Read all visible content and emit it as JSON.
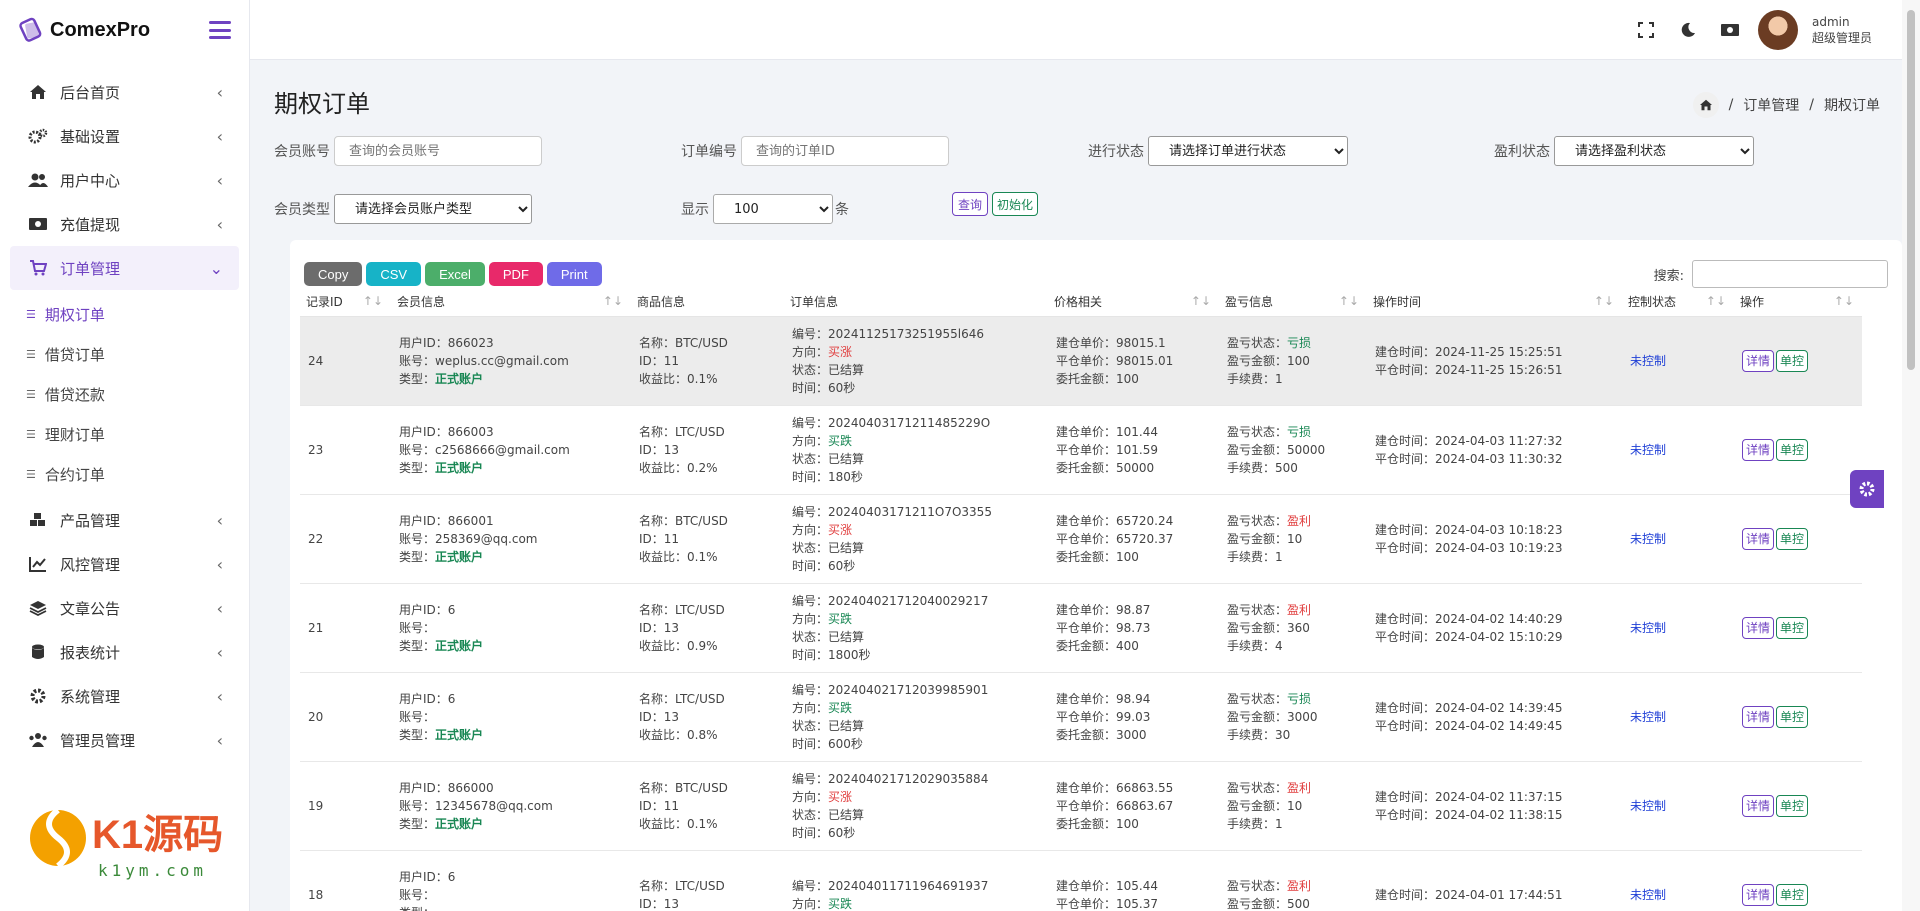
{
  "brand": {
    "name": "ComexPro"
  },
  "colors": {
    "accent": "#6f42c1",
    "green": "#198754",
    "red": "#e03e3e",
    "control": "#1f3fd6"
  },
  "sidebar": {
    "items": [
      {
        "label": "后台首页",
        "icon": "home-icon"
      },
      {
        "label": "基础设置",
        "icon": "gears-icon"
      },
      {
        "label": "用户中心",
        "icon": "users-icon"
      },
      {
        "label": "充值提现",
        "icon": "money-icon"
      },
      {
        "label": "订单管理",
        "icon": "cart-icon",
        "active": true
      },
      {
        "label": "产品管理",
        "icon": "cubes-icon"
      },
      {
        "label": "风控管理",
        "icon": "chart-line-icon"
      },
      {
        "label": "文章公告",
        "icon": "layers-icon"
      },
      {
        "label": "报表统计",
        "icon": "database-icon"
      },
      {
        "label": "系统管理",
        "icon": "gear-icon"
      },
      {
        "label": "管理员管理",
        "icon": "user-group-icon"
      }
    ],
    "submenu": [
      "期权订单",
      "借贷订单",
      "借贷还款",
      "理财订单",
      "合约订单"
    ]
  },
  "watermark": {
    "text": "K1源码",
    "url": "k1ym.com"
  },
  "user": {
    "name": "admin",
    "role": "超级管理员"
  },
  "page": {
    "title": "期权订单"
  },
  "breadcrumb": {
    "parent": "订单管理",
    "current": "期权订单",
    "sep": "/"
  },
  "filters": {
    "member_account_label": "会员账号",
    "member_account_placeholder": "查询的会员账号",
    "order_no_label": "订单编号",
    "order_no_placeholder": "查询的订单ID",
    "progress_label": "进行状态",
    "progress_value": "请选择订单进行状态",
    "profit_label": "盈利状态",
    "profit_value": "请选择盈利状态",
    "member_type_label": "会员类型",
    "member_type_value": "请选择会员账户类型",
    "show_label": "显示",
    "show_value": "100",
    "show_unit": "条",
    "query": "查询",
    "reset": "初始化"
  },
  "export": {
    "copy": "Copy",
    "csv": "CSV",
    "excel": "Excel",
    "pdf": "PDF",
    "print": "Print"
  },
  "search_label": "搜索:",
  "table": {
    "headers": [
      "记录ID",
      "会员信息",
      "商品信息",
      "订单信息",
      "价格相关",
      "盈亏信息",
      "操作时间",
      "控制状态",
      "操作"
    ],
    "rows": [
      {
        "id": "24",
        "uid": "用户ID：866023",
        "account": "账号：weplus.cc@gmail.com",
        "type_label": "类型：",
        "type": "正式账户",
        "product": "名称：BTC/USD",
        "pid": "ID：11",
        "ratio": "收益比：0.1%",
        "order_no": "编号：20241125173251955l646",
        "dir_label": "方向：",
        "dir": "买涨",
        "dir_color": "red",
        "state": "状态：已结算",
        "duration": "时间：60秒",
        "open_price": "建仓单价：98015.1",
        "close_price": "平仓单价：98015.01",
        "amount": "委托金额：100",
        "pl_label": "盈亏状态：",
        "pl": "亏损",
        "pl_color": "green",
        "pl_amount": "盈亏金额：100",
        "fee": "手续费：1",
        "open_time": "建仓时间：2024-11-25 15:25:51",
        "close_time": "平仓时间：2024-11-25 15:26:51",
        "control": "未控制",
        "detail": "详情",
        "single": "单控"
      },
      {
        "id": "23",
        "uid": "用户ID：866003",
        "account": "账号：c2568666@gmail.com",
        "type_label": "类型：",
        "type": "正式账户",
        "product": "名称：LTC/USD",
        "pid": "ID：13",
        "ratio": "收益比：0.2%",
        "order_no": "编号：20240403171211485229O",
        "dir_label": "方向：",
        "dir": "买跌",
        "dir_color": "green",
        "state": "状态：已结算",
        "duration": "时间：180秒",
        "open_price": "建仓单价：101.44",
        "close_price": "平仓单价：101.59",
        "amount": "委托金额：50000",
        "pl_label": "盈亏状态：",
        "pl": "亏损",
        "pl_color": "green",
        "pl_amount": "盈亏金额：50000",
        "fee": "手续费：500",
        "open_time": "建仓时间：2024-04-03 11:27:32",
        "close_time": "平仓时间：2024-04-03 11:30:32",
        "control": "未控制",
        "detail": "详情",
        "single": "单控"
      },
      {
        "id": "22",
        "uid": "用户ID：866001",
        "account": "账号：258369@qq.com",
        "type_label": "类型：",
        "type": "正式账户",
        "product": "名称：BTC/USD",
        "pid": "ID：11",
        "ratio": "收益比：0.1%",
        "order_no": "编号：20240403171211O7O3355",
        "dir_label": "方向：",
        "dir": "买涨",
        "dir_color": "red",
        "state": "状态：已结算",
        "duration": "时间：60秒",
        "open_price": "建仓单价：65720.24",
        "close_price": "平仓单价：65720.37",
        "amount": "委托金额：100",
        "pl_label": "盈亏状态：",
        "pl": "盈利",
        "pl_color": "red",
        "pl_amount": "盈亏金额：10",
        "fee": "手续费：1",
        "open_time": "建仓时间：2024-04-03 10:18:23",
        "close_time": "平仓时间：2024-04-03 10:19:23",
        "control": "未控制",
        "detail": "详情",
        "single": "单控"
      },
      {
        "id": "21",
        "uid": "用户ID：6",
        "account": "账号：",
        "type_label": "类型：",
        "type": "正式账户",
        "product": "名称：LTC/USD",
        "pid": "ID：13",
        "ratio": "收益比：0.9%",
        "order_no": "编号：202404021712040029217",
        "dir_label": "方向：",
        "dir": "买跌",
        "dir_color": "green",
        "state": "状态：已结算",
        "duration": "时间：1800秒",
        "open_price": "建仓单价：98.87",
        "close_price": "平仓单价：98.73",
        "amount": "委托金额：400",
        "pl_label": "盈亏状态：",
        "pl": "盈利",
        "pl_color": "red",
        "pl_amount": "盈亏金额：360",
        "fee": "手续费：4",
        "open_time": "建仓时间：2024-04-02 14:40:29",
        "close_time": "平仓时间：2024-04-02 15:10:29",
        "control": "未控制",
        "detail": "详情",
        "single": "单控"
      },
      {
        "id": "20",
        "uid": "用户ID：6",
        "account": "账号：",
        "type_label": "类型：",
        "type": "正式账户",
        "product": "名称：LTC/USD",
        "pid": "ID：13",
        "ratio": "收益比：0.8%",
        "order_no": "编号：202404021712039985901",
        "dir_label": "方向：",
        "dir": "买跌",
        "dir_color": "green",
        "state": "状态：已结算",
        "duration": "时间：600秒",
        "open_price": "建仓单价：98.94",
        "close_price": "平仓单价：99.03",
        "amount": "委托金额：3000",
        "pl_label": "盈亏状态：",
        "pl": "亏损",
        "pl_color": "green",
        "pl_amount": "盈亏金额：3000",
        "fee": "手续费：30",
        "open_time": "建仓时间：2024-04-02 14:39:45",
        "close_time": "平仓时间：2024-04-02 14:49:45",
        "control": "未控制",
        "detail": "详情",
        "single": "单控"
      },
      {
        "id": "19",
        "uid": "用户ID：866000",
        "account": "账号：12345678@qq.com",
        "type_label": "类型：",
        "type": "正式账户",
        "product": "名称：BTC/USD",
        "pid": "ID：11",
        "ratio": "收益比：0.1%",
        "order_no": "编号：202404021712029035884",
        "dir_label": "方向：",
        "dir": "买涨",
        "dir_color": "red",
        "state": "状态：已结算",
        "duration": "时间：60秒",
        "open_price": "建仓单价：66863.55",
        "close_price": "平仓单价：66863.67",
        "amount": "委托金额：100",
        "pl_label": "盈亏状态：",
        "pl": "盈利",
        "pl_color": "red",
        "pl_amount": "盈亏金额：10",
        "fee": "手续费：1",
        "open_time": "建仓时间：2024-04-02 11:37:15",
        "close_time": "平仓时间：2024-04-02 11:38:15",
        "control": "未控制",
        "detail": "详情",
        "single": "单控"
      },
      {
        "id": "18",
        "uid": "用户ID：6",
        "account": "账号：",
        "type_label": "类型：",
        "type": "",
        "product": "名称：LTC/USD",
        "pid": "ID：13",
        "ratio": "",
        "order_no": "编号：202404011711964691937",
        "dir_label": "方向：",
        "dir": "买跌",
        "dir_color": "green",
        "state": "",
        "duration": "",
        "open_price": "建仓单价：105.44",
        "close_price": "平仓单价：105.37",
        "amount": "",
        "pl_label": "盈亏状态：",
        "pl": "盈利",
        "pl_color": "red",
        "pl_amount": "盈亏金额：500",
        "fee": "",
        "open_time": "建仓时间：2024-04-01 17:44:51",
        "close_time": "",
        "control": "未控制",
        "detail": "详情",
        "single": "单控"
      }
    ]
  }
}
